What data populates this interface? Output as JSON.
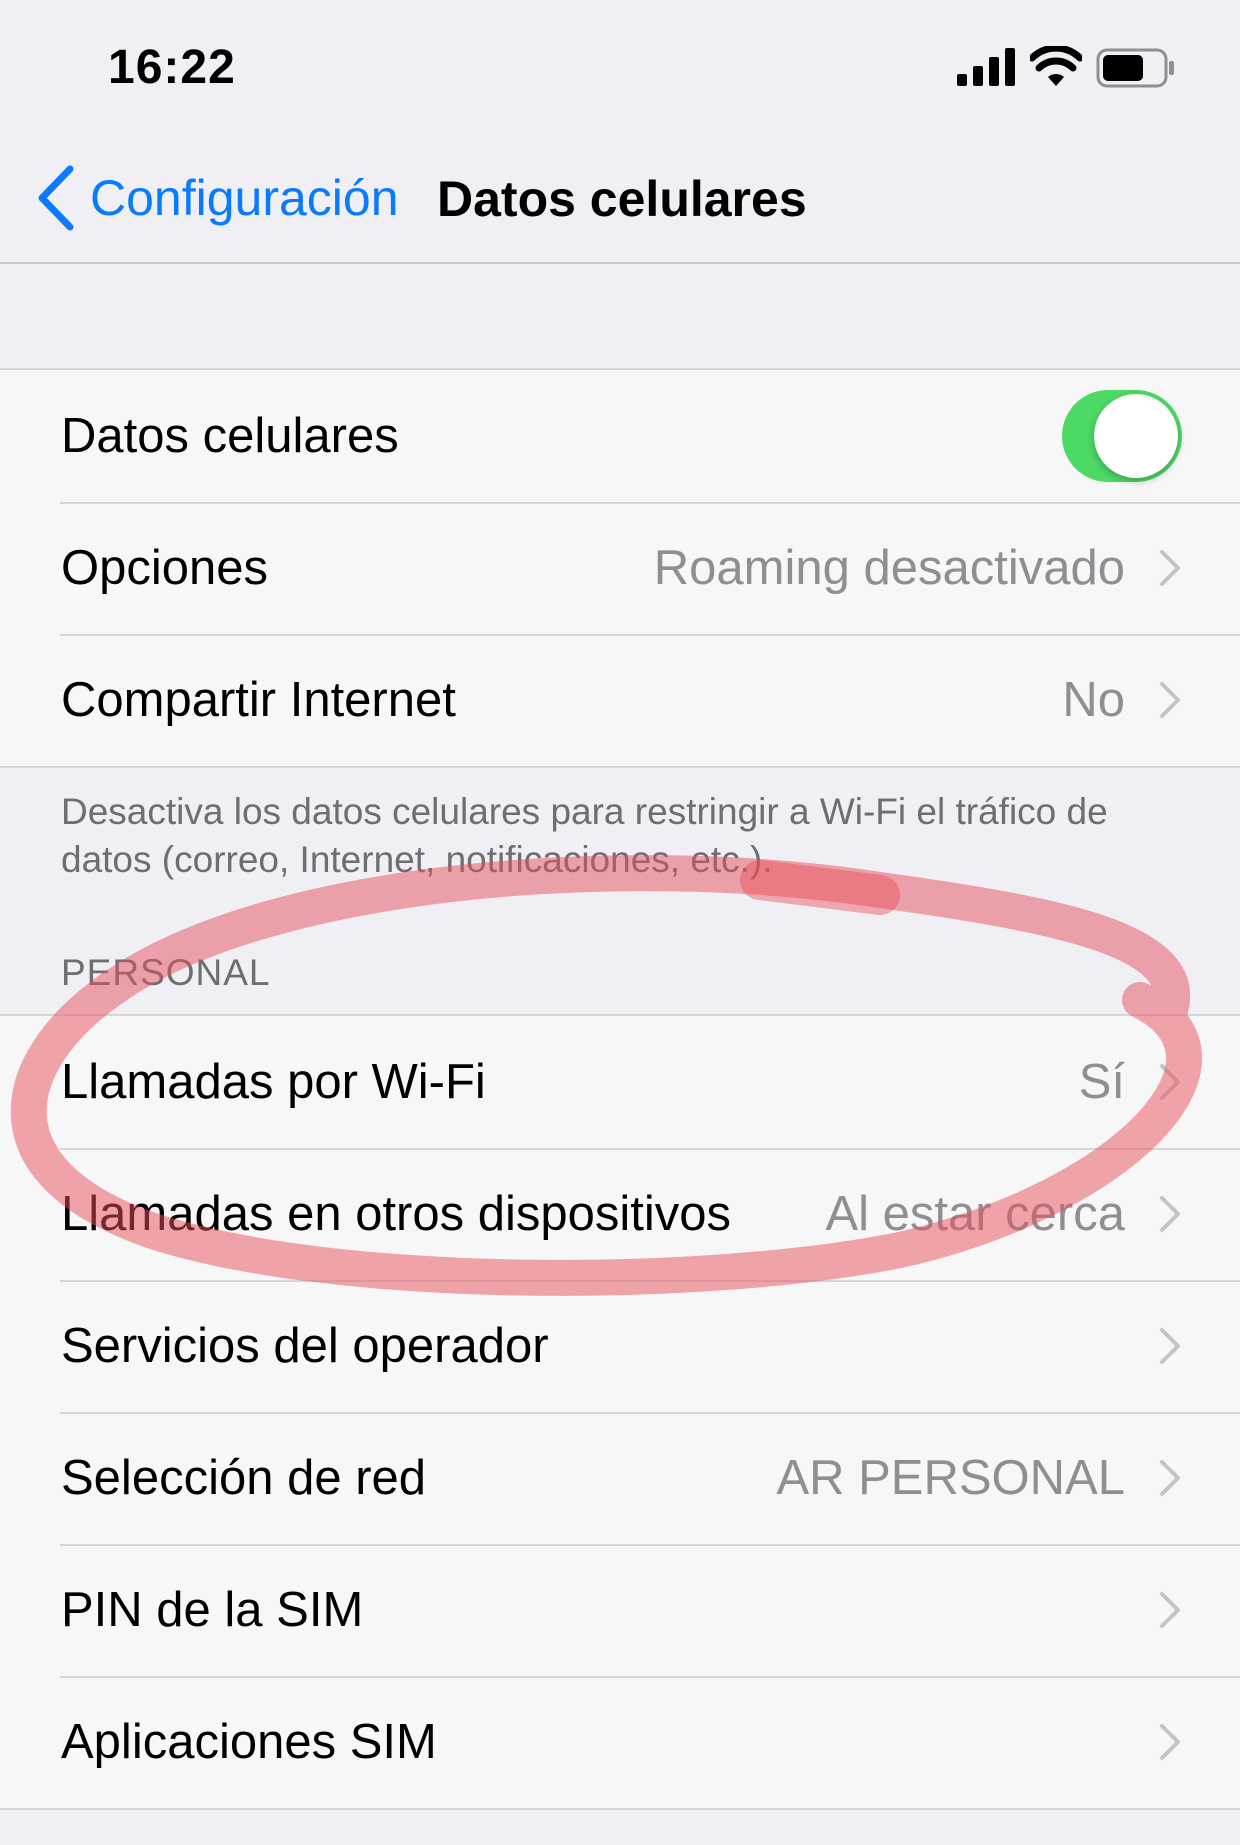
{
  "status_bar": {
    "time": "16:22",
    "icons": [
      "signal-icon",
      "wifi-icon",
      "battery-icon"
    ]
  },
  "nav": {
    "back_label": "Configuración",
    "title": "Datos celulares"
  },
  "group1": {
    "rows": [
      {
        "label": "Datos celulares",
        "toggle_on": true
      },
      {
        "label": "Opciones",
        "value": "Roaming desactivado"
      },
      {
        "label": "Compartir Internet",
        "value": "No"
      }
    ],
    "footer": "Desactiva los datos celulares para restringir a Wi-Fi el tráfico de datos (correo, Internet, notificaciones, etc.)."
  },
  "personal": {
    "header": "PERSONAL",
    "rows": [
      {
        "label": "Llamadas por Wi-Fi",
        "value": "Sí"
      },
      {
        "label": "Llamadas en otros dispositivos",
        "value": "Al estar cerca"
      },
      {
        "label": "Servicios del operador",
        "value": ""
      },
      {
        "label": "Selección de red",
        "value": "AR PERSONAL"
      },
      {
        "label": "PIN de la SIM",
        "value": ""
      },
      {
        "label": "Aplicaciones SIM",
        "value": ""
      }
    ]
  },
  "colors": {
    "accent": "#0a7aff",
    "toggle_on": "#4cd964",
    "annotation": "#e8505b"
  }
}
